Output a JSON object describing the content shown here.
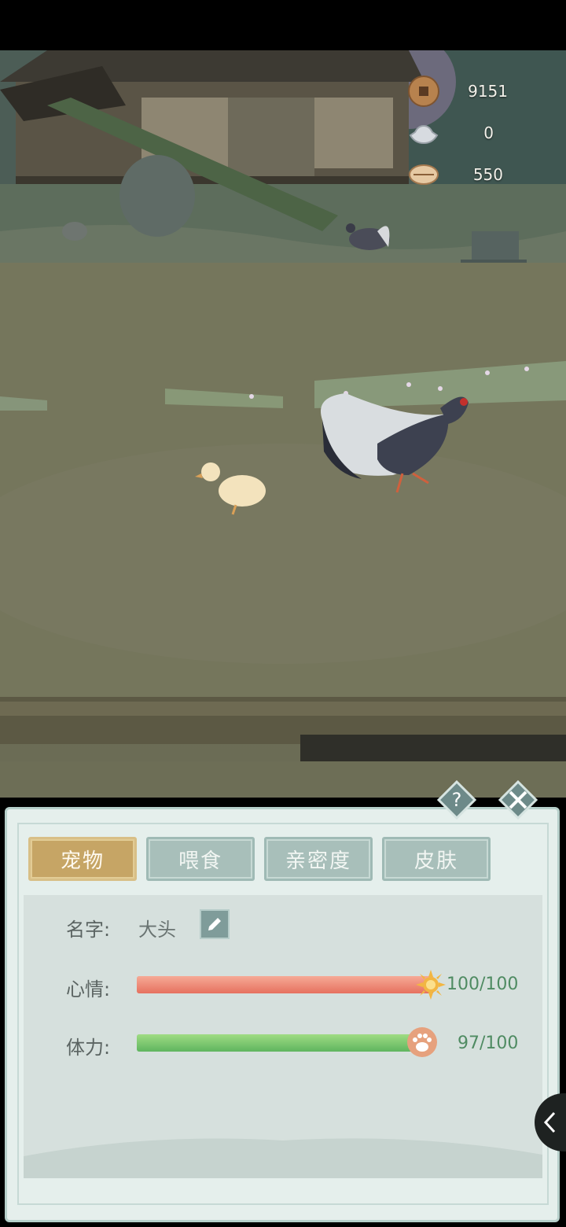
{
  "currency": {
    "coins": {
      "icon": "copper-coin-icon",
      "value": "9151"
    },
    "silver": {
      "icon": "silver-ingot-icon",
      "value": "0"
    },
    "shell": {
      "icon": "cowrie-shell-icon",
      "value": "550"
    }
  },
  "tabs": [
    {
      "label": "宠物",
      "active": true
    },
    {
      "label": "喂食",
      "active": false
    },
    {
      "label": "亲密度",
      "active": false
    },
    {
      "label": "皮肤",
      "active": false
    }
  ],
  "pet": {
    "name_label": "名字:",
    "name": "大头",
    "mood_label": "心情:",
    "mood_value": "100/100",
    "mood_fraction": 1.0,
    "stamina_label": "体力:",
    "stamina_value": "97/100",
    "stamina_fraction": 0.97
  },
  "icons": {
    "help": "question-icon",
    "close": "close-icon",
    "edit": "pencil-icon",
    "mood": "sun-icon",
    "stamina": "paw-icon",
    "side_toggle": "chevron-left-icon"
  },
  "colors": {
    "active_tab": "#c6a565",
    "inactive_tab": "#a8bfba",
    "mood_bar": "#e6715f",
    "stamina_bar": "#5fb55f",
    "value_text": "#4f8b62"
  }
}
